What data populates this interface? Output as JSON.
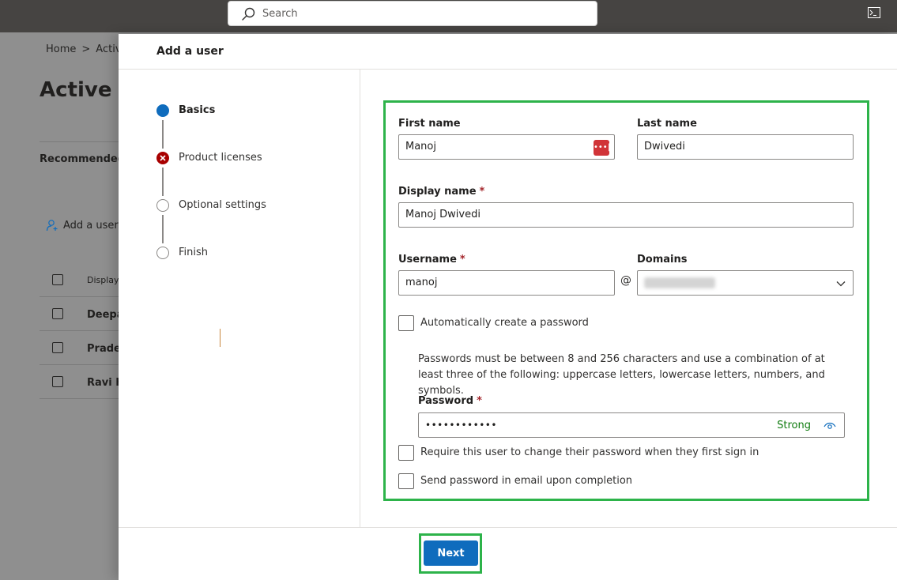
{
  "topbar": {
    "search_placeholder": "Search"
  },
  "background": {
    "breadcrumb_home": "Home",
    "breadcrumb_sep": ">",
    "breadcrumb_current": "Activ",
    "title": "Active u",
    "tab_recommended": "Recommended",
    "add_user": "Add a user",
    "column_display": "Display",
    "rows": [
      "Deepa",
      "Pradee",
      "Ravi K"
    ]
  },
  "panel": {
    "title": "Add a user",
    "steps": [
      {
        "label": "Basics",
        "state": "active"
      },
      {
        "label": "Product licenses",
        "state": "error"
      },
      {
        "label": "Optional settings",
        "state": "pending"
      },
      {
        "label": "Finish",
        "state": "pending"
      }
    ],
    "form": {
      "first_name_label": "First name",
      "first_name_value": "Manoj",
      "last_name_label": "Last name",
      "last_name_value": "Dwivedi",
      "display_name_label": "Display name",
      "display_name_value": "Manoj Dwivedi",
      "required_marker": "*",
      "username_label": "Username",
      "username_value": "manoj",
      "at_sign": "@",
      "domains_label": "Domains",
      "auto_password_label": "Automatically create a password",
      "password_hint": "Passwords must be between 8 and 256 characters and use a combination of at least three of the following: uppercase letters, lowercase letters, numbers, and symbols.",
      "password_label": "Password",
      "password_mask": "••••••••••••",
      "password_strength": "Strong",
      "require_change_label": "Require this user to change their password when they first sign in",
      "send_email_label": "Send password in email upon completion"
    },
    "next_label": "Next"
  },
  "colors": {
    "accent": "#0f6cbd",
    "highlight": "#2db34a",
    "error": "#a80000",
    "strong": "#107c10",
    "topbar": "#464442"
  }
}
